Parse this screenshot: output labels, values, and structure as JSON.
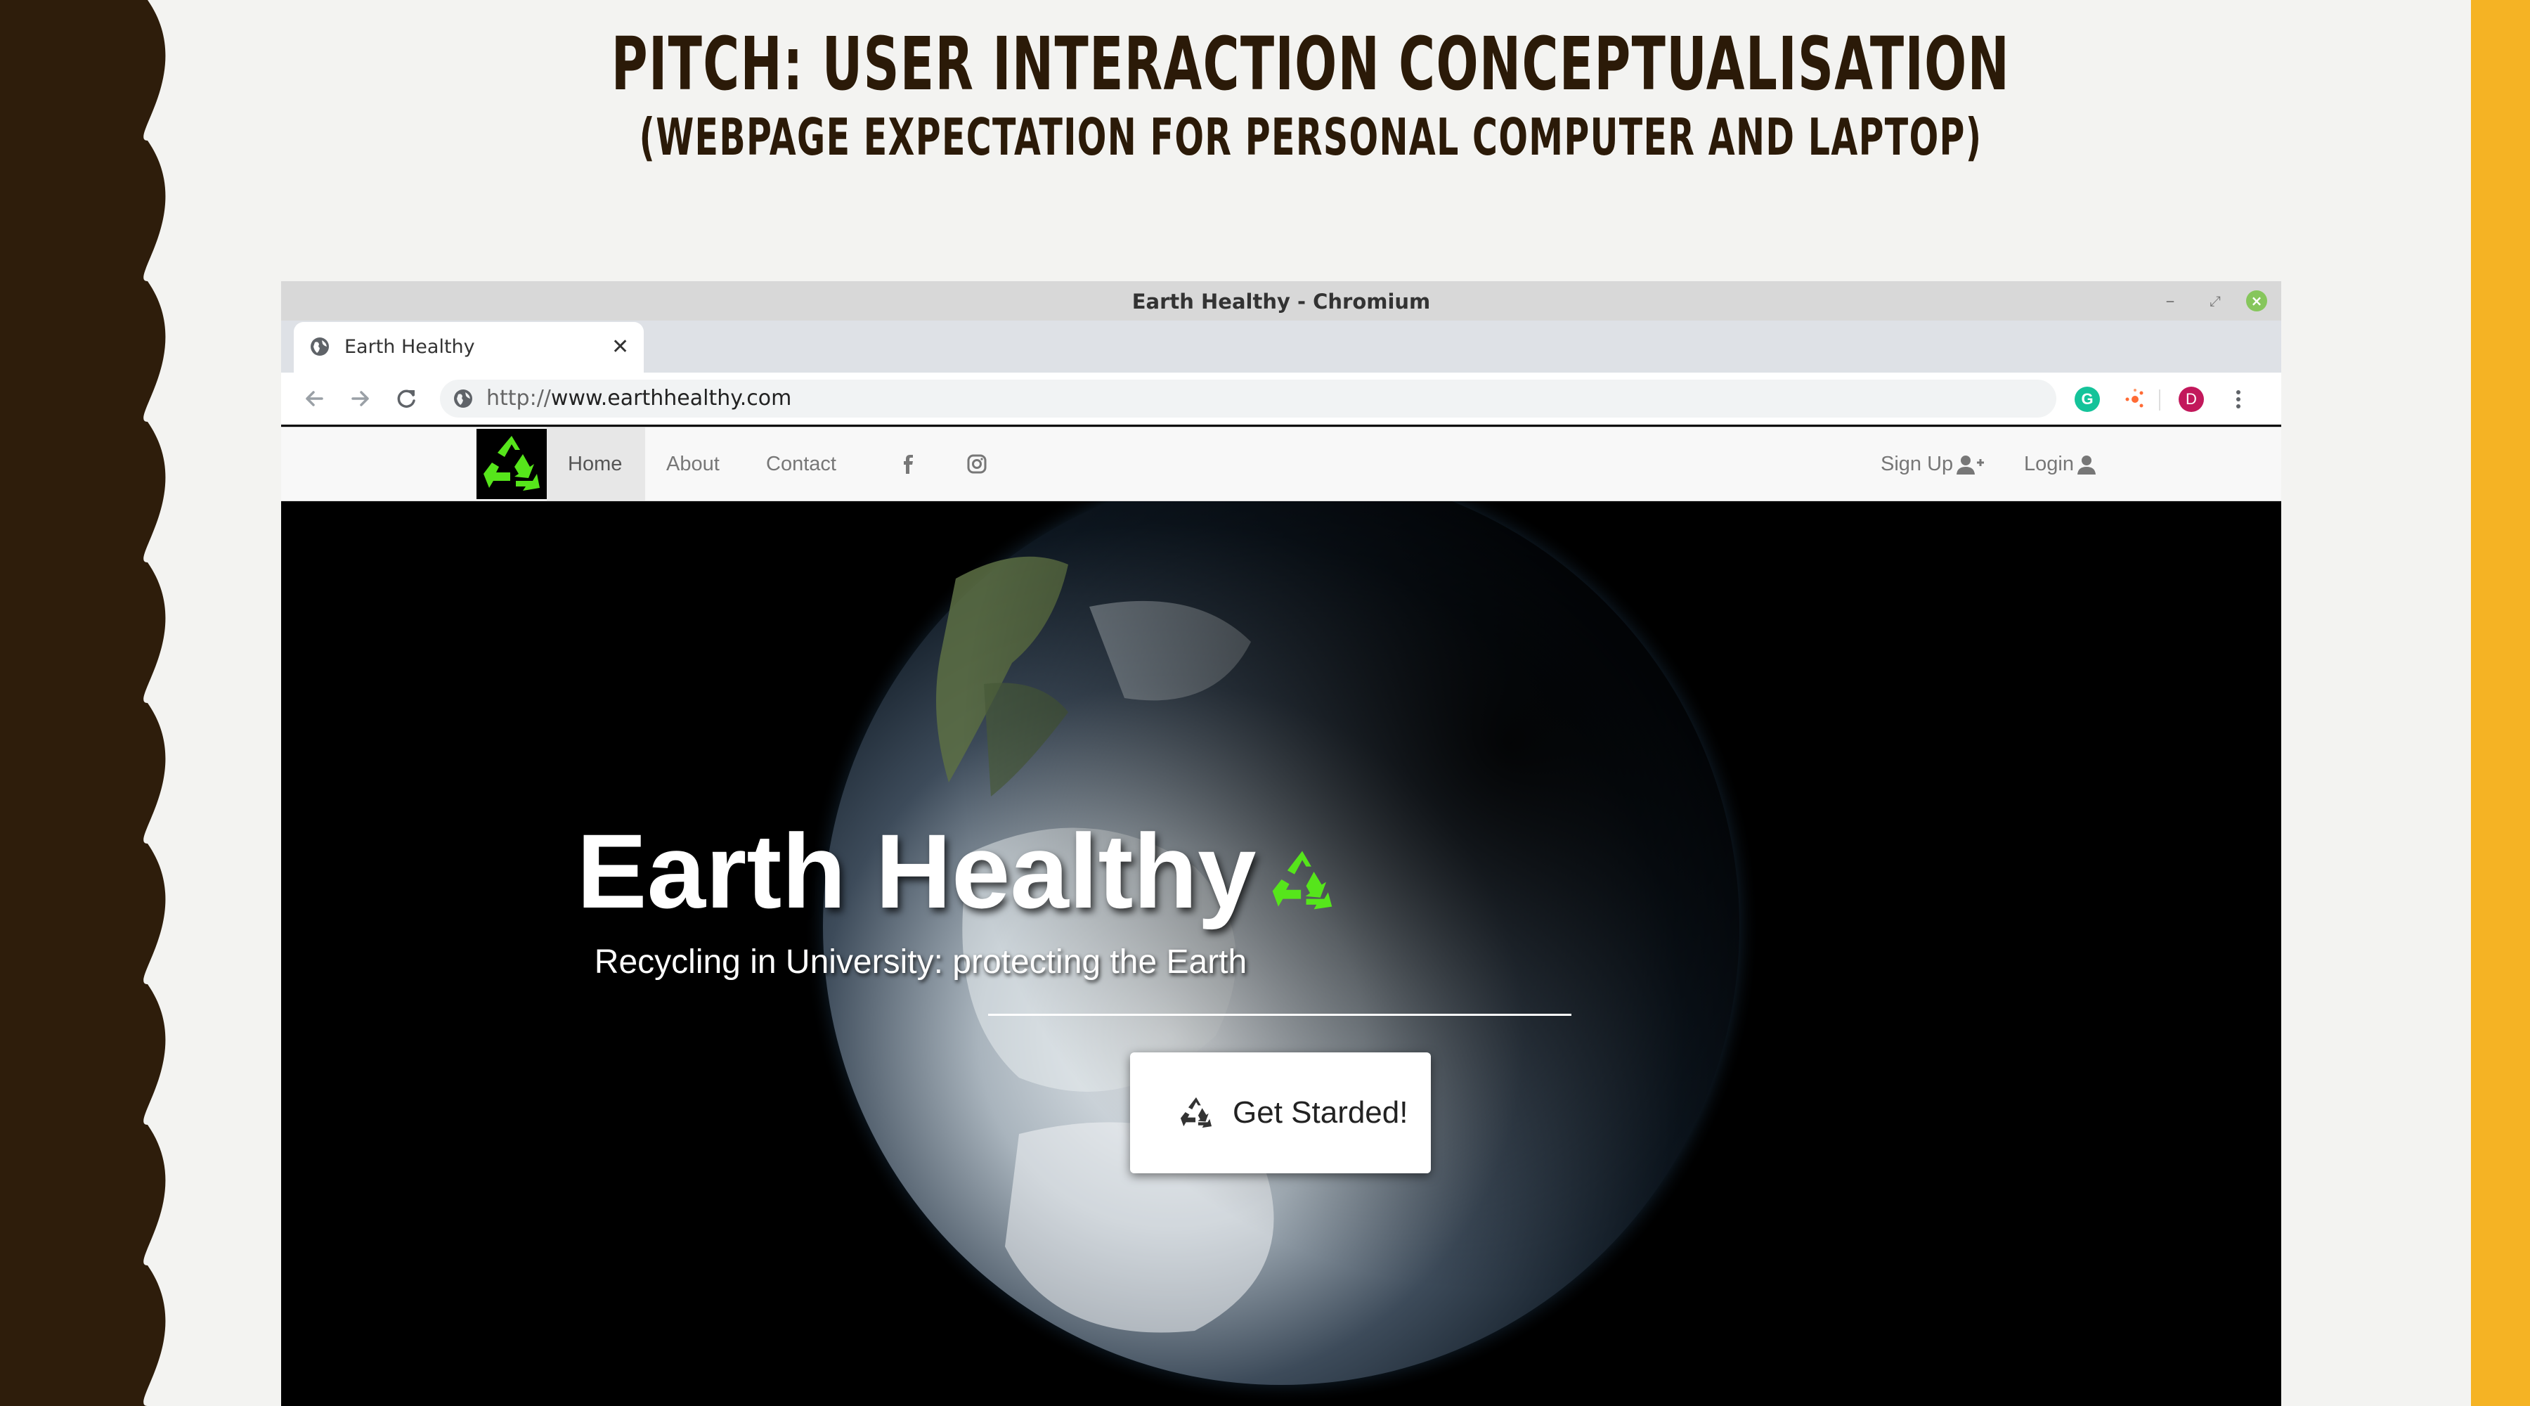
{
  "slide": {
    "title": "Pitch: User Interaction Conceptualisation",
    "subtitle": "(Webpage expectation for personal computer and laptop)",
    "colors": {
      "left_wave": "#2e1d0b",
      "right_bar": "#f5b324",
      "background": "#f3f3f1",
      "title_text": "#2b1a08"
    }
  },
  "browser": {
    "window_title": "Earth Healthy - Chromium",
    "controls": {
      "minimize_icon": "minimize-icon",
      "maximize_icon": "maximize-icon",
      "close_icon": "close-icon"
    },
    "tab": {
      "title": "Earth Healthy",
      "favicon": "globe-icon",
      "close": "✕"
    },
    "new_tab": "+",
    "url": {
      "scheme": "http://",
      "host": "www.earthhealthy.com"
    },
    "extensions": {
      "grammarly": "G",
      "profile": "D"
    }
  },
  "site": {
    "logo": "recycle-icon",
    "nav": {
      "home": "Home",
      "about": "About",
      "contact": "Contact",
      "signup": "Sign Up",
      "login": "Login"
    },
    "hero": {
      "title": "Earth Healthy",
      "subtitle": "Recycling in University: protecting the Earth",
      "cta": "Get Starded!"
    },
    "colors": {
      "recycle_green": "#56e51b",
      "navbar_bg": "#f8f8f8",
      "hero_bg": "#000000"
    }
  }
}
